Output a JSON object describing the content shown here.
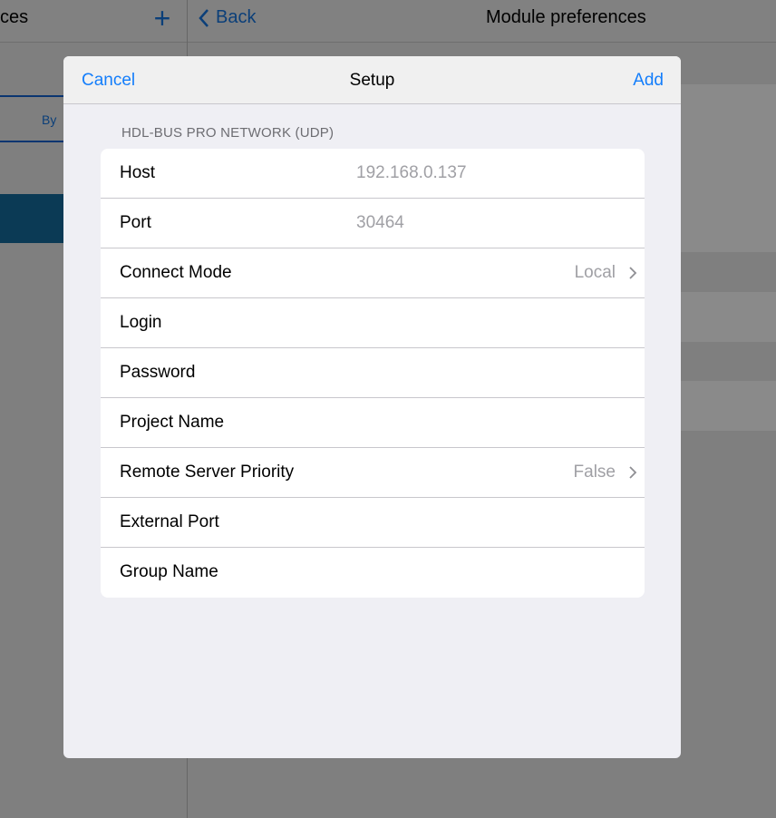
{
  "background": {
    "left_title": "ces",
    "back_label": "Back",
    "right_title": "Module preferences",
    "segment_label": "By"
  },
  "modal": {
    "cancel_label": "Cancel",
    "title": "Setup",
    "add_label": "Add",
    "section_header": "HDL-BUS PRO NETWORK (UDP)",
    "rows": [
      {
        "label": "Host",
        "value": "192.168.0.137"
      },
      {
        "label": "Port",
        "value": "30464"
      },
      {
        "label": "Connect Mode",
        "detail": "Local"
      },
      {
        "label": "Login"
      },
      {
        "label": "Password"
      },
      {
        "label": "Project Name"
      },
      {
        "label": "Remote Server Priority",
        "detail": "False"
      },
      {
        "label": "External Port"
      },
      {
        "label": "Group Name"
      }
    ]
  },
  "colors": {
    "accent": "#147efb",
    "placeholder": "#a0a0a5"
  }
}
